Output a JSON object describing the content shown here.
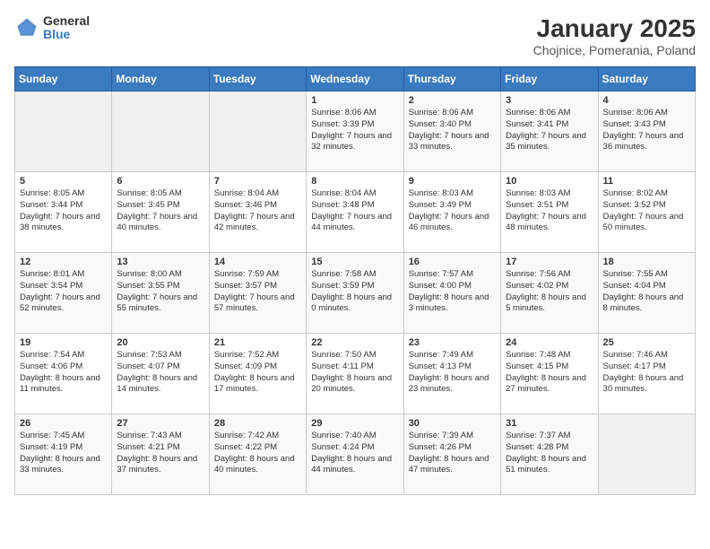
{
  "header": {
    "logo_general": "General",
    "logo_blue": "Blue",
    "title": "January 2025",
    "subtitle": "Chojnice, Pomerania, Poland"
  },
  "days_of_week": [
    "Sunday",
    "Monday",
    "Tuesday",
    "Wednesday",
    "Thursday",
    "Friday",
    "Saturday"
  ],
  "weeks": [
    [
      {
        "day": "",
        "content": ""
      },
      {
        "day": "",
        "content": ""
      },
      {
        "day": "",
        "content": ""
      },
      {
        "day": "1",
        "content": "Sunrise: 8:06 AM\nSunset: 3:39 PM\nDaylight: 7 hours and 32 minutes."
      },
      {
        "day": "2",
        "content": "Sunrise: 8:06 AM\nSunset: 3:40 PM\nDaylight: 7 hours and 33 minutes."
      },
      {
        "day": "3",
        "content": "Sunrise: 8:06 AM\nSunset: 3:41 PM\nDaylight: 7 hours and 35 minutes."
      },
      {
        "day": "4",
        "content": "Sunrise: 8:06 AM\nSunset: 3:43 PM\nDaylight: 7 hours and 36 minutes."
      }
    ],
    [
      {
        "day": "5",
        "content": "Sunrise: 8:05 AM\nSunset: 3:44 PM\nDaylight: 7 hours and 38 minutes."
      },
      {
        "day": "6",
        "content": "Sunrise: 8:05 AM\nSunset: 3:45 PM\nDaylight: 7 hours and 40 minutes."
      },
      {
        "day": "7",
        "content": "Sunrise: 8:04 AM\nSunset: 3:46 PM\nDaylight: 7 hours and 42 minutes."
      },
      {
        "day": "8",
        "content": "Sunrise: 8:04 AM\nSunset: 3:48 PM\nDaylight: 7 hours and 44 minutes."
      },
      {
        "day": "9",
        "content": "Sunrise: 8:03 AM\nSunset: 3:49 PM\nDaylight: 7 hours and 46 minutes."
      },
      {
        "day": "10",
        "content": "Sunrise: 8:03 AM\nSunset: 3:51 PM\nDaylight: 7 hours and 48 minutes."
      },
      {
        "day": "11",
        "content": "Sunrise: 8:02 AM\nSunset: 3:52 PM\nDaylight: 7 hours and 50 minutes."
      }
    ],
    [
      {
        "day": "12",
        "content": "Sunrise: 8:01 AM\nSunset: 3:54 PM\nDaylight: 7 hours and 52 minutes."
      },
      {
        "day": "13",
        "content": "Sunrise: 8:00 AM\nSunset: 3:55 PM\nDaylight: 7 hours and 55 minutes."
      },
      {
        "day": "14",
        "content": "Sunrise: 7:59 AM\nSunset: 3:57 PM\nDaylight: 7 hours and 57 minutes."
      },
      {
        "day": "15",
        "content": "Sunrise: 7:58 AM\nSunset: 3:59 PM\nDaylight: 8 hours and 0 minutes."
      },
      {
        "day": "16",
        "content": "Sunrise: 7:57 AM\nSunset: 4:00 PM\nDaylight: 8 hours and 3 minutes."
      },
      {
        "day": "17",
        "content": "Sunrise: 7:56 AM\nSunset: 4:02 PM\nDaylight: 8 hours and 5 minutes."
      },
      {
        "day": "18",
        "content": "Sunrise: 7:55 AM\nSunset: 4:04 PM\nDaylight: 8 hours and 8 minutes."
      }
    ],
    [
      {
        "day": "19",
        "content": "Sunrise: 7:54 AM\nSunset: 4:06 PM\nDaylight: 8 hours and 11 minutes."
      },
      {
        "day": "20",
        "content": "Sunrise: 7:53 AM\nSunset: 4:07 PM\nDaylight: 8 hours and 14 minutes."
      },
      {
        "day": "21",
        "content": "Sunrise: 7:52 AM\nSunset: 4:09 PM\nDaylight: 8 hours and 17 minutes."
      },
      {
        "day": "22",
        "content": "Sunrise: 7:50 AM\nSunset: 4:11 PM\nDaylight: 8 hours and 20 minutes."
      },
      {
        "day": "23",
        "content": "Sunrise: 7:49 AM\nSunset: 4:13 PM\nDaylight: 8 hours and 23 minutes."
      },
      {
        "day": "24",
        "content": "Sunrise: 7:48 AM\nSunset: 4:15 PM\nDaylight: 8 hours and 27 minutes."
      },
      {
        "day": "25",
        "content": "Sunrise: 7:46 AM\nSunset: 4:17 PM\nDaylight: 8 hours and 30 minutes."
      }
    ],
    [
      {
        "day": "26",
        "content": "Sunrise: 7:45 AM\nSunset: 4:19 PM\nDaylight: 8 hours and 33 minutes."
      },
      {
        "day": "27",
        "content": "Sunrise: 7:43 AM\nSunset: 4:21 PM\nDaylight: 8 hours and 37 minutes."
      },
      {
        "day": "28",
        "content": "Sunrise: 7:42 AM\nSunset: 4:22 PM\nDaylight: 8 hours and 40 minutes."
      },
      {
        "day": "29",
        "content": "Sunrise: 7:40 AM\nSunset: 4:24 PM\nDaylight: 8 hours and 44 minutes."
      },
      {
        "day": "30",
        "content": "Sunrise: 7:39 AM\nSunset: 4:26 PM\nDaylight: 8 hours and 47 minutes."
      },
      {
        "day": "31",
        "content": "Sunrise: 7:37 AM\nSunset: 4:28 PM\nDaylight: 8 hours and 51 minutes."
      },
      {
        "day": "",
        "content": ""
      }
    ]
  ]
}
